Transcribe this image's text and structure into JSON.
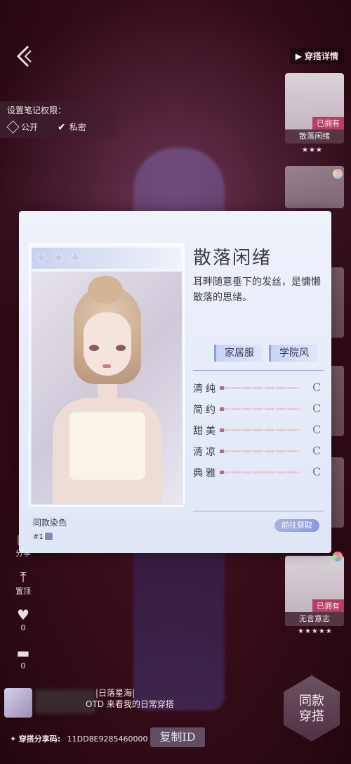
{
  "header": {
    "detail_link": "穿搭详情"
  },
  "permissions": {
    "title": "设置笔记权限：",
    "options": [
      {
        "label": "公开",
        "checked": false
      },
      {
        "label": "私密",
        "checked": true
      }
    ]
  },
  "side_cards": [
    {
      "name": "散落闲绪",
      "owned": "已拥有",
      "stars": "★★★"
    },
    {
      "name": "无言意志",
      "owned": "已拥有",
      "stars": "★★★★★"
    }
  ],
  "left_actions": [
    {
      "label": "分享",
      "icon": "share-icon"
    },
    {
      "label": "置顶",
      "icon": "pin-top-icon"
    },
    {
      "label": "0",
      "icon": "heart-icon"
    },
    {
      "label": "0",
      "icon": "comment-icon"
    }
  ],
  "share": {
    "line1": "|日落星海|",
    "line2": "OTD 来看我的日常穿搭",
    "code_label": "穿搭分享码:",
    "code_value": "11DD8E9285460000",
    "copy_button": "复制ID",
    "same_outfit_line1": "同款",
    "same_outfit_line2": "穿搭"
  },
  "item": {
    "title": "散落闲绪",
    "description": "耳畔随意垂下的发丝，是慵懒散落的思绪。",
    "tags": [
      "家居服",
      "学院风"
    ],
    "attributes": [
      {
        "label": "清纯",
        "level": 0.05,
        "grade": "C"
      },
      {
        "label": "简约",
        "level": 0.05,
        "grade": "C"
      },
      {
        "label": "甜美",
        "level": 0.05,
        "grade": "C"
      },
      {
        "label": "清凉",
        "level": 0.05,
        "grade": "C"
      },
      {
        "label": "典雅",
        "level": 0.05,
        "grade": "C"
      }
    ],
    "dye_label": "同款染色",
    "dye_number": "#1",
    "dye_color": "#8e84c4",
    "goto_button": "前往获取"
  }
}
